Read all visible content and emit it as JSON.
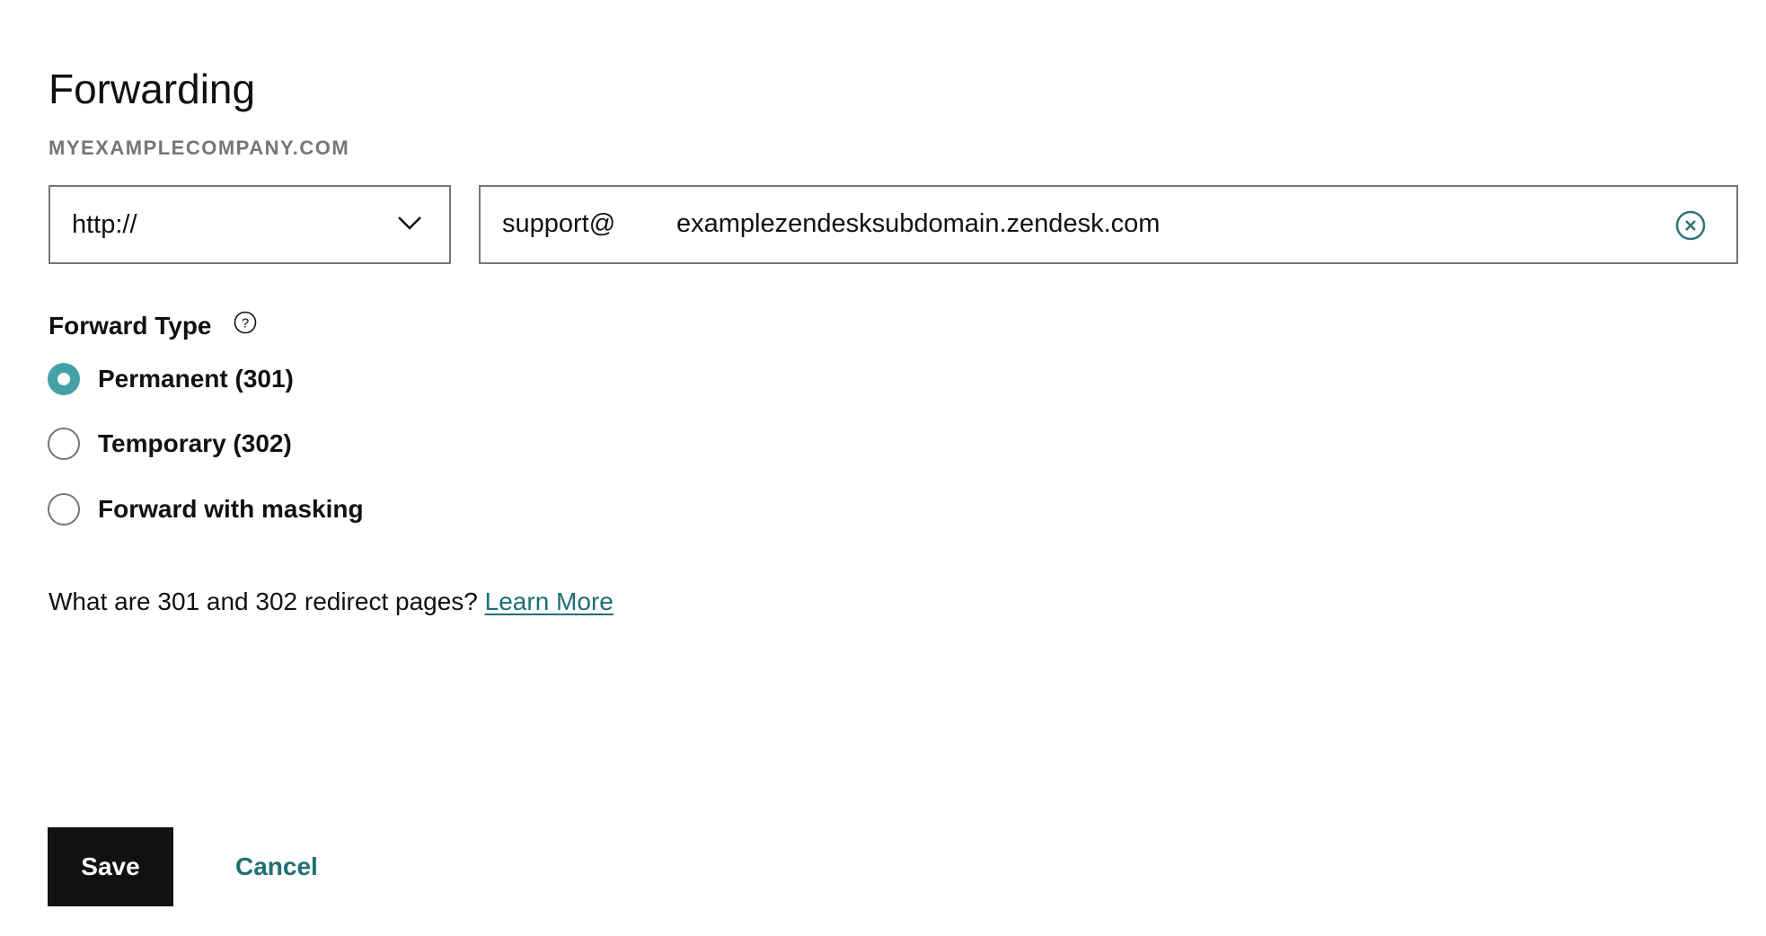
{
  "header": {
    "title": "Forwarding",
    "domain": "MYEXAMPLECOMPANY.COM"
  },
  "protocol_select": {
    "value": "http://",
    "icon": "chevron-down-icon"
  },
  "destination": {
    "prefix": "support@",
    "value": "examplezendesksubdomain.zendesk.com",
    "clear_icon": "close-circle-icon"
  },
  "forward_type": {
    "label": "Forward Type",
    "help_icon": "question-circle-icon",
    "options": [
      {
        "label": "Permanent (301)",
        "selected": true
      },
      {
        "label": "Temporary (302)",
        "selected": false
      },
      {
        "label": "Forward with masking",
        "selected": false
      }
    ]
  },
  "info": {
    "text": "What are 301 and 302 redirect pages? ",
    "link": "Learn More"
  },
  "actions": {
    "save": "Save",
    "cancel": "Cancel"
  },
  "colors": {
    "accent": "#44a2a6",
    "link": "#1f6f73",
    "primary_button": "#111111",
    "border": "#767676"
  }
}
